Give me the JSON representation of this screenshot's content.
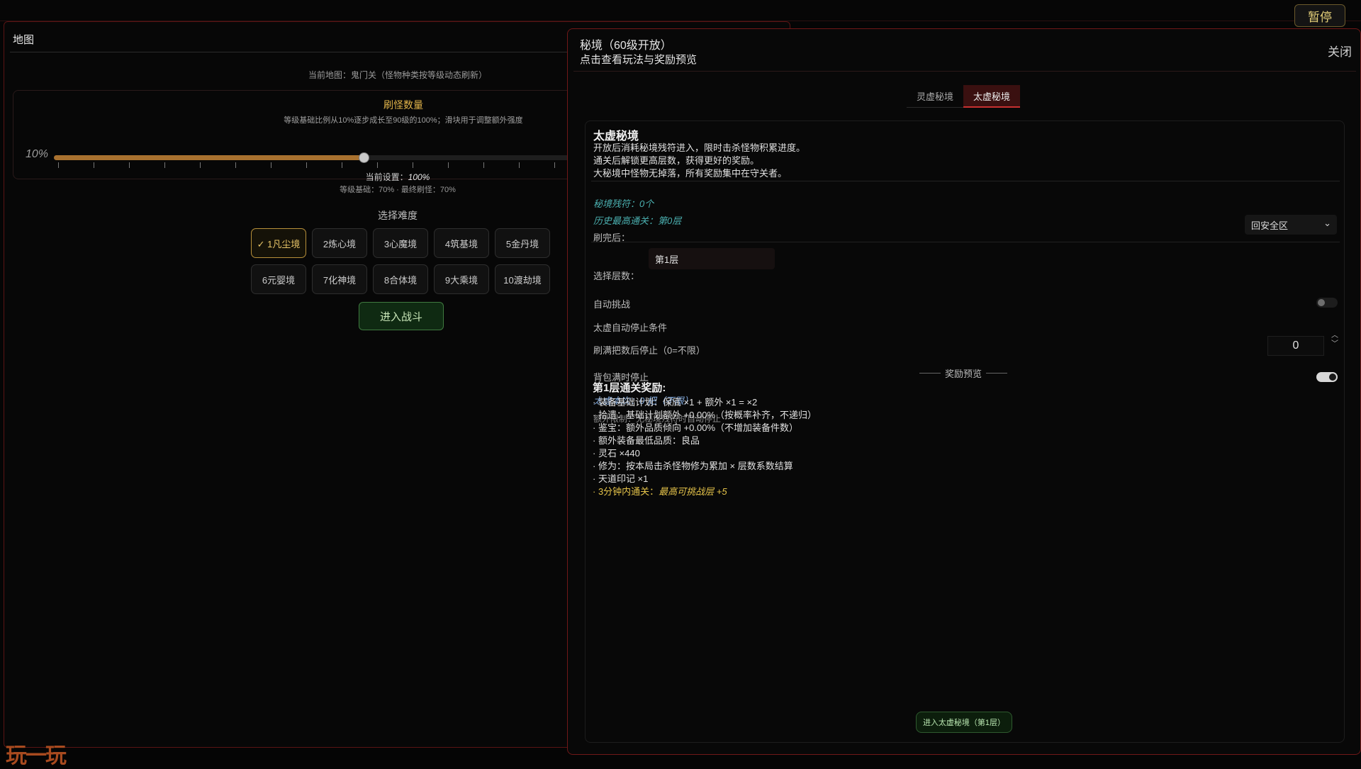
{
  "topbar": {
    "pause_label": "暂停"
  },
  "map": {
    "title": "地图",
    "current_map": "当前地图：鬼门关（怪物种类按等级动态刷新）",
    "monster_count": {
      "title": "刷怪数量",
      "desc": "等级基础比例从10%逐步成长至90级的100%；滑块用于调整额外强度",
      "min_label": "10%",
      "value_fraction": 0.6,
      "setting_label": "当前设置：",
      "setting_value": "100%",
      "base_info": "等级基础：70% · 最终刷怪：70%"
    },
    "difficulty": {
      "title": "选择难度",
      "options": [
        "✓ 1凡尘境",
        "2炼心境",
        "3心魔境",
        "4筑基境",
        "5金丹境",
        "6元婴境",
        "7化神境",
        "8合体境",
        "9大乘境",
        "10渡劫境"
      ],
      "selected_index": 0
    },
    "enter_battle": "进入战斗"
  },
  "dialog": {
    "title": "秘境（60级开放）",
    "subtitle": "点击查看玩法与奖励预览",
    "close": "关闭",
    "tabs": [
      "灵虚秘境",
      "太虚秘境"
    ],
    "active_tab": 1,
    "name": "太虚秘境",
    "desc": [
      "开放后消耗秘境残符进入，限时击杀怪物积累进度。",
      "通关后解锁更高层数，获得更好的奖励。",
      "大秘境中怪物无掉落，所有奖励集中在守关者。"
    ],
    "talisman": "秘境残符：0个",
    "best_clear": "历史最高通关：第0层",
    "after_clear_label": "刷完后：",
    "after_clear_value": "回安全区",
    "layer_label": "选择层数：",
    "layer_value": "第1层",
    "auto_challenge": {
      "label": "自动挑战",
      "on": false
    },
    "stop_cond_title": "太虚自动停止条件",
    "stop_after_label": "刷满把数后停止（0=不限）",
    "stop_after_value": "0",
    "bag_full": {
      "label": "背包满时停止",
      "on": true
    },
    "this_run": "太虚本次：0 把（不限）",
    "extra_limit": "额外限制：无秘境残符时自动停止",
    "reward_title": "奖励预览",
    "reward_head": "第1层通关奖励:",
    "rewards": [
      "· 装备基础计划：保底 ×1 + 额外 ×1 = ×2",
      "· 拾遗：基础计划额外 +0.00%（按概率补齐，不递归）",
      "· 鉴宝：额外品质倾向 +0.00%（不增加装备件数）",
      "· 额外装备最低品质：良品",
      "· 灵石 ×440",
      "· 修为：按本局击杀怪物修为累加 × 层数系数结算",
      "· 天道印记 ×1"
    ],
    "bonus_prefix": "· 3分钟内通关：",
    "bonus_value": "最高可挑战层 +5",
    "enter_label": "进入太虚秘境（第1层）"
  },
  "logo": "玩一玩",
  "colors": {
    "accent_red": "#701818",
    "gold": "#e6c44a",
    "teal": "#4bb0b0",
    "green": "#3f7a3f"
  }
}
